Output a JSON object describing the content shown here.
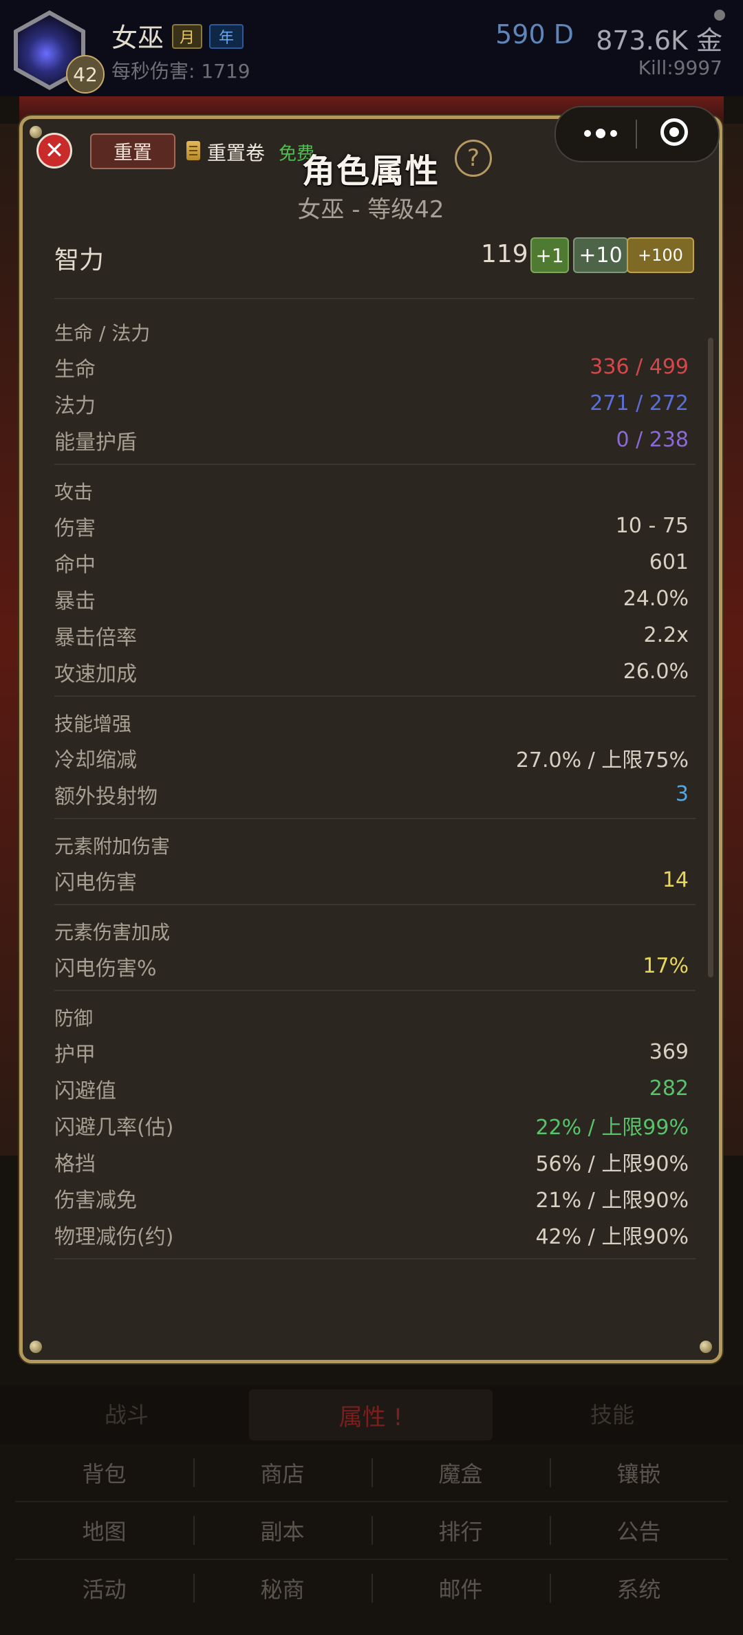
{
  "header": {
    "hero_name": "女巫",
    "tag_month": "月",
    "tag_year": "年",
    "level": "42",
    "dps": "每秒伤害: 1719",
    "currency_d": "590 D",
    "gold": "873.6K 金",
    "kill": "Kill:9997"
  },
  "dialog": {
    "reset_label": "重置",
    "reset_scroll_label": "重置卷",
    "free_label": "免费",
    "title": "角色属性",
    "help": "?",
    "subtitle": "女巫 - 等级42",
    "primary_stat": {
      "label": "智力",
      "value": "119"
    },
    "buttons": {
      "plus1": "+1",
      "plus10": "+10",
      "plus100": "+100"
    },
    "sections": [
      {
        "title": "生命 / 法力",
        "rows": [
          {
            "label": "生命",
            "value": "336 / 499",
            "color": "#d4474b"
          },
          {
            "label": "法力",
            "value": "271 / 272",
            "color": "#5a6fd8"
          },
          {
            "label": "能量护盾",
            "value": "0 / 238",
            "color": "#8c6ad6"
          }
        ]
      },
      {
        "title": "攻击",
        "rows": [
          {
            "label": "伤害",
            "value": "10 - 75",
            "color": "#d8d0c2"
          },
          {
            "label": "命中",
            "value": "601",
            "color": "#d8d0c2"
          },
          {
            "label": "暴击",
            "value": "24.0%",
            "color": "#d8d0c2"
          },
          {
            "label": "暴击倍率",
            "value": "2.2x",
            "color": "#d8d0c2"
          },
          {
            "label": "攻速加成",
            "value": "26.0%",
            "color": "#d8d0c2"
          }
        ]
      },
      {
        "title": "技能增强",
        "rows": [
          {
            "label": "冷却缩减",
            "value": "27.0% / 上限75%",
            "color": "#d8d0c2"
          },
          {
            "label": "额外投射物",
            "value": "3",
            "color": "#4fa8e8"
          }
        ]
      },
      {
        "title": "元素附加伤害",
        "rows": [
          {
            "label": "闪电伤害",
            "value": "14",
            "color": "#e8d85a"
          }
        ]
      },
      {
        "title": "元素伤害加成",
        "rows": [
          {
            "label": "闪电伤害%",
            "value": "17%",
            "color": "#e8d85a"
          }
        ]
      },
      {
        "title": "防御",
        "rows": [
          {
            "label": "护甲",
            "value": "369",
            "color": "#d8d0c2"
          },
          {
            "label": "闪避值",
            "value": "282",
            "color": "#58c46a"
          },
          {
            "label": "闪避几率(估)",
            "value": "22% / 上限99%",
            "color": "#58c46a"
          },
          {
            "label": "格挡",
            "value": "56% / 上限90%",
            "color": "#d8d0c2"
          },
          {
            "label": "伤害减免",
            "value": "21% / 上限90%",
            "color": "#d8d0c2"
          },
          {
            "label": "物理减伤(约)",
            "value": "42% / 上限90%",
            "color": "#d8d0c2"
          }
        ]
      }
    ]
  },
  "tabs": {
    "fight": "战斗",
    "attr": "属性 !",
    "skill": "技能"
  },
  "menu": [
    [
      "背包",
      "商店",
      "魔盒",
      "镶嵌"
    ],
    [
      "地图",
      "副本",
      "排行",
      "公告"
    ],
    [
      "活动",
      "秘商",
      "邮件",
      "系统"
    ]
  ]
}
